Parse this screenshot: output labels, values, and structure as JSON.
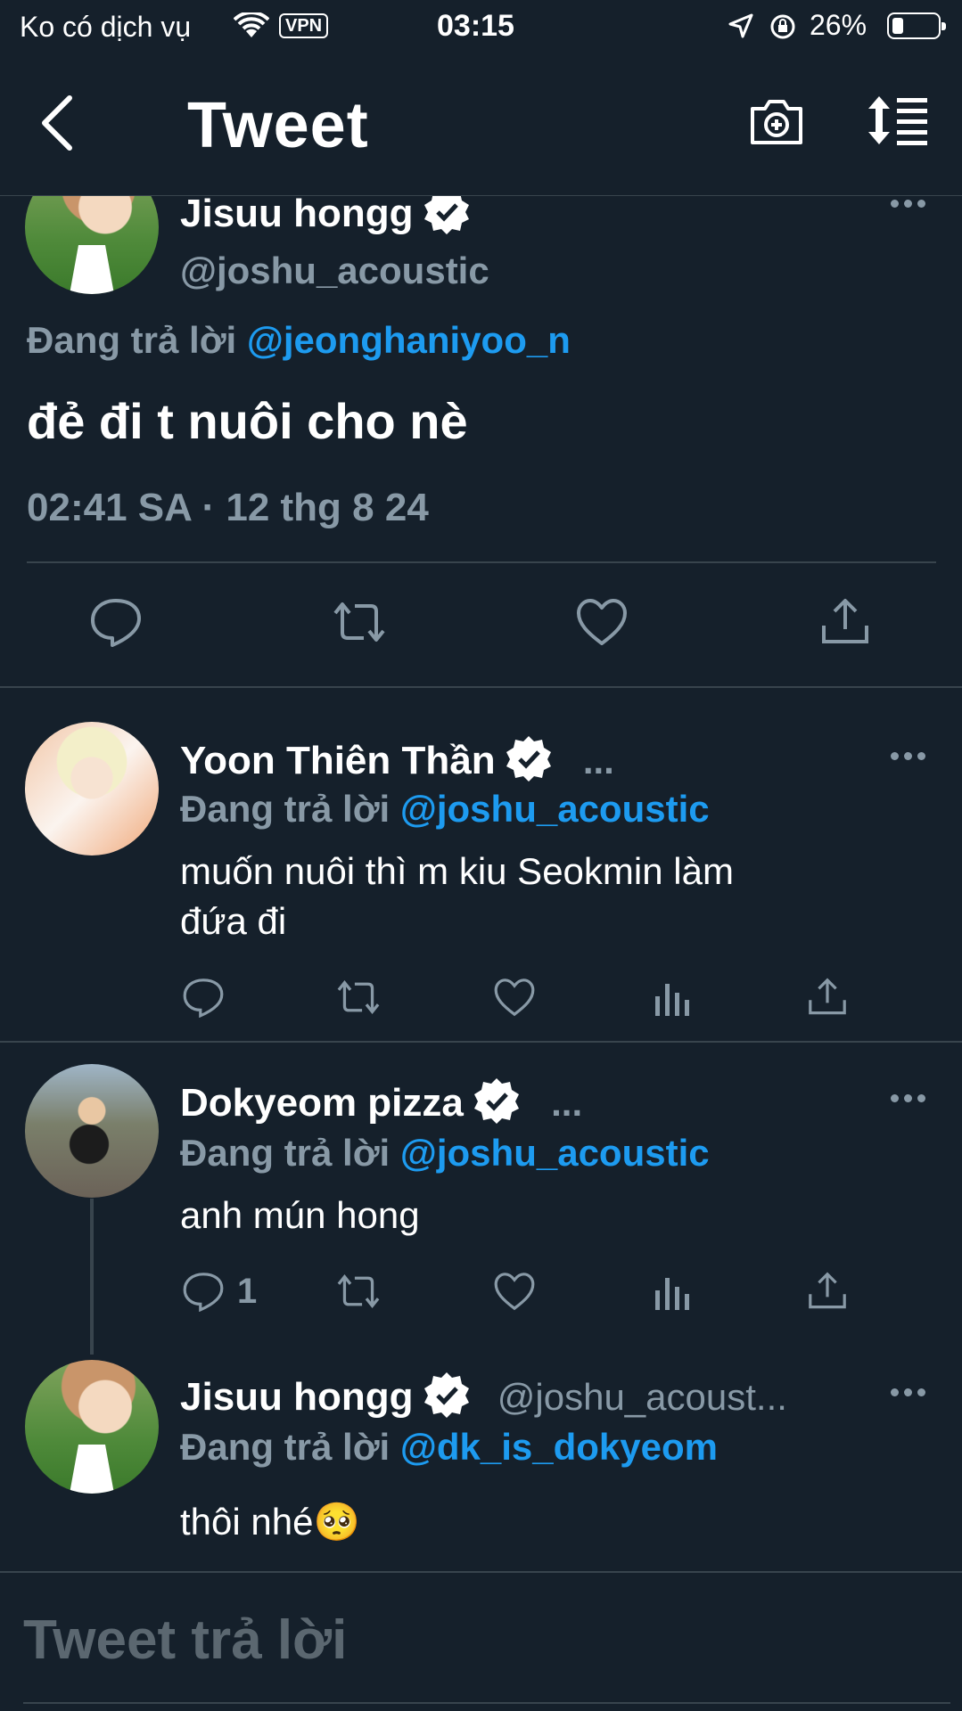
{
  "status_bar": {
    "carrier": "Ko có dịch vụ",
    "vpn": "VPN",
    "time": "03:15",
    "battery": "26%",
    "battery_level": 0.26
  },
  "nav": {
    "title": "Tweet",
    "icons": [
      "back-arrow-icon",
      "camera-plus-icon",
      "sort-icon"
    ]
  },
  "main_tweet": {
    "author_name": "Jisuu hongg",
    "handle": "@joshu_acoustic",
    "replying_label": "Đang trả lời",
    "replying_to": "@jeonghaniyoo_n",
    "text": "đẻ đi t nuôi cho nè",
    "timestamp": "02:41 SA · 12 thg 8 24",
    "actions": [
      "reply-icon",
      "retweet-icon",
      "like-icon",
      "share-icon"
    ]
  },
  "replies": [
    {
      "author_name": "Yoon Thiên Thần",
      "handle_trunc": "...",
      "replying_label": "Đang trả lời",
      "replying_to": "@joshu_acoustic",
      "text_line1": "muốn nuôi thì m kiu Seokmin làm",
      "text_line2": "đứa đi",
      "reply_count": ""
    },
    {
      "author_name": "Dokyeom pizza",
      "handle_trunc": "...",
      "replying_label": "Đang trả lời",
      "replying_to": "@joshu_acoustic",
      "text_line1": "anh mún hong",
      "reply_count": "1"
    },
    {
      "author_name": "Jisuu hongg",
      "handle_trunc": "@joshu_acoust...",
      "replying_label": "Đang trả lời",
      "replying_to": "@dk_is_dokyeom",
      "text_line1": "thôi nhé🥺"
    }
  ],
  "compose": {
    "placeholder": "Tweet trả lời"
  },
  "colors": {
    "background": "#15202b",
    "accent": "#1d9bf0",
    "muted": "#8899a6",
    "divider": "#38444d"
  }
}
